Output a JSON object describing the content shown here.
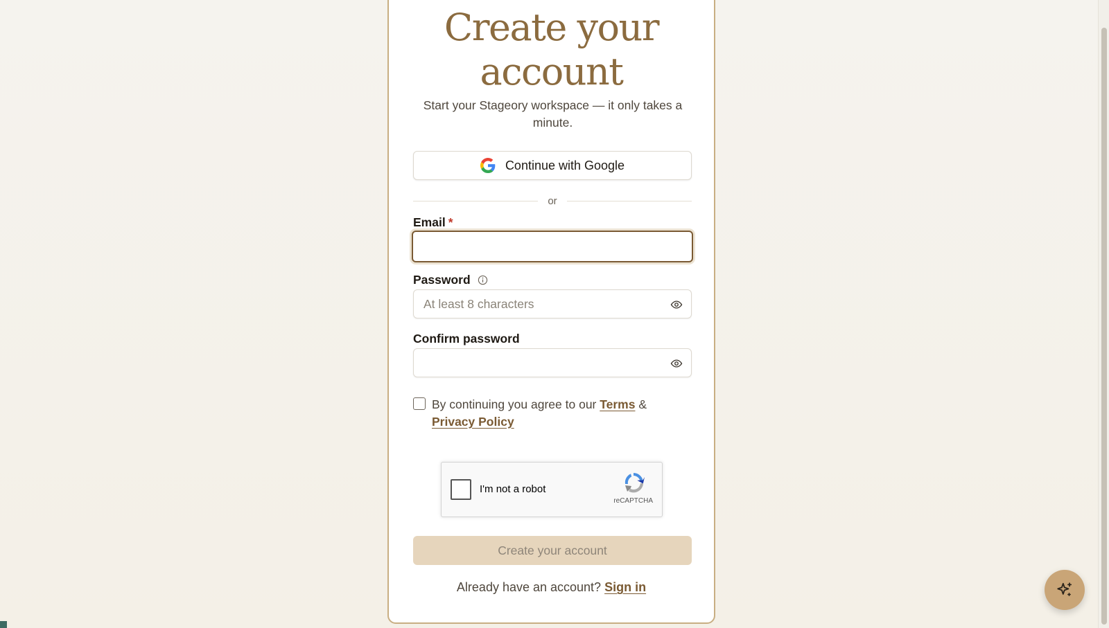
{
  "card": {
    "title_line1": "Create your",
    "title_line2": "account",
    "subtitle": "Start your Stageory workspace — it only takes a minute."
  },
  "google_button": {
    "label": "Continue with Google",
    "icon": "google-icon"
  },
  "divider": {
    "text": "or"
  },
  "email": {
    "label": "Email",
    "required_marker": "*",
    "value": "",
    "placeholder": ""
  },
  "password": {
    "label": "Password",
    "placeholder": "At least 8 characters",
    "info_icon": "info-icon",
    "toggle_icon": "eye-icon"
  },
  "confirm_password": {
    "label": "Confirm password",
    "placeholder": "",
    "toggle_icon": "eye-icon"
  },
  "terms": {
    "prefix": "By continuing you agree to our ",
    "terms_link": "Terms",
    "joiner": " &",
    "privacy_link": "Privacy Policy",
    "checked": false
  },
  "recaptcha": {
    "label": "I'm not a robot",
    "brand": "reCAPTCHA"
  },
  "submit": {
    "label": "Create your account",
    "enabled": false
  },
  "signin": {
    "prompt": "Already have an account? ",
    "link": "Sign in"
  },
  "fab": {
    "icon": "sparkles-icon"
  },
  "colors": {
    "accent": "#8b6b3f",
    "card_border": "#c8ae82",
    "submit_disabled_bg": "#e6d5bc",
    "fab_bg": "#c9a577",
    "required": "#c0392b"
  }
}
